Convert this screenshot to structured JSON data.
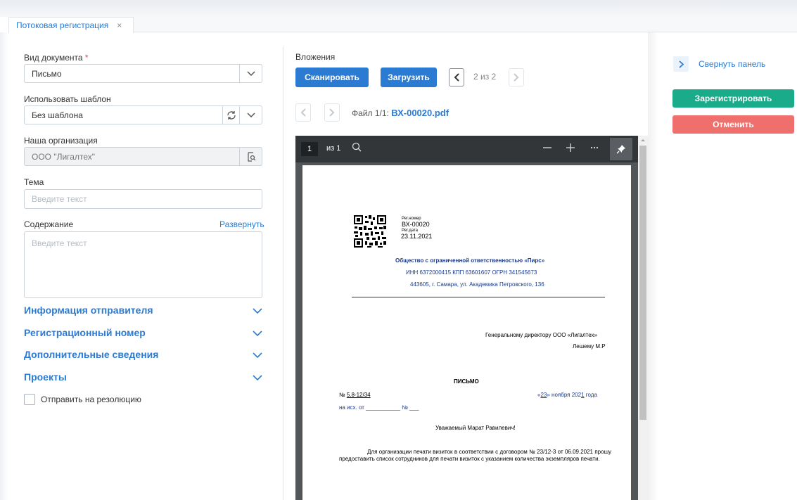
{
  "tab": {
    "label": "Потоковая регистрация",
    "close": "×"
  },
  "form": {
    "doc_type": {
      "label": "Вид документа",
      "required": "*",
      "value": "Письмо"
    },
    "template": {
      "label": "Использовать шаблон",
      "value": "Без шаблона"
    },
    "org": {
      "label": "Наша организация",
      "value": "ООО \"Лигалтех\""
    },
    "subject": {
      "label": "Тема",
      "placeholder": "Введите текст"
    },
    "content": {
      "label": "Содержание",
      "expand": "Развернуть",
      "placeholder": "Введите текст"
    },
    "sections": [
      "Информация отправителя",
      "Регистрационный номер",
      "Дополнительные сведения",
      "Проекты"
    ],
    "send_resolution": "Отправить на резолюцию"
  },
  "attachments": {
    "label": "Вложения",
    "scan": "Сканировать",
    "upload": "Загрузить",
    "counter": "2 из 2",
    "file_prefix": "Файл 1/1:",
    "file_name": "ВХ-00020.pdf"
  },
  "viewer": {
    "page": "1",
    "of": "из 1",
    "doc": {
      "reg_num_label": "Рег.номер",
      "reg_num": "ВХ-00020",
      "reg_date_label": "Рег.дата",
      "reg_date": "23.11.2021",
      "company": "Общество с ограниченной ответственностью «Пирс»",
      "inn": "ИНН 6372000415 КПП 63601607 ОГРН 341545673",
      "address": "443605, г. Самара, ул. Академика Петровского, 136",
      "to1": "Генеральному директору ООО «Лигалтех»",
      "to2": "Лешему М.Р",
      "title": "ПИСЬМО",
      "num_prefix": "№ ",
      "num": "5.8-12/34",
      "date_open": "«",
      "date_day": "23",
      "date_rest": "» ноября 202",
      "date_yr": "1",
      "date_end": " года",
      "ref": "на исх. от ___________ № ___",
      "greeting": "Уважаемый Марат Равилевич!",
      "body": "Для организации печати визиток в соответствии с договором № 23/12-3 от 06.09.2021 прошу предоставить список сотрудников для печати визиток с указанием количества экземпляров печати."
    }
  },
  "right": {
    "collapse": "Свернуть панель",
    "register": "Зарегистрировать",
    "cancel": "Отменить"
  },
  "colors": {
    "primary": "#2b7bd3",
    "register": "#1aab8a",
    "cancel": "#ef6f6c"
  }
}
